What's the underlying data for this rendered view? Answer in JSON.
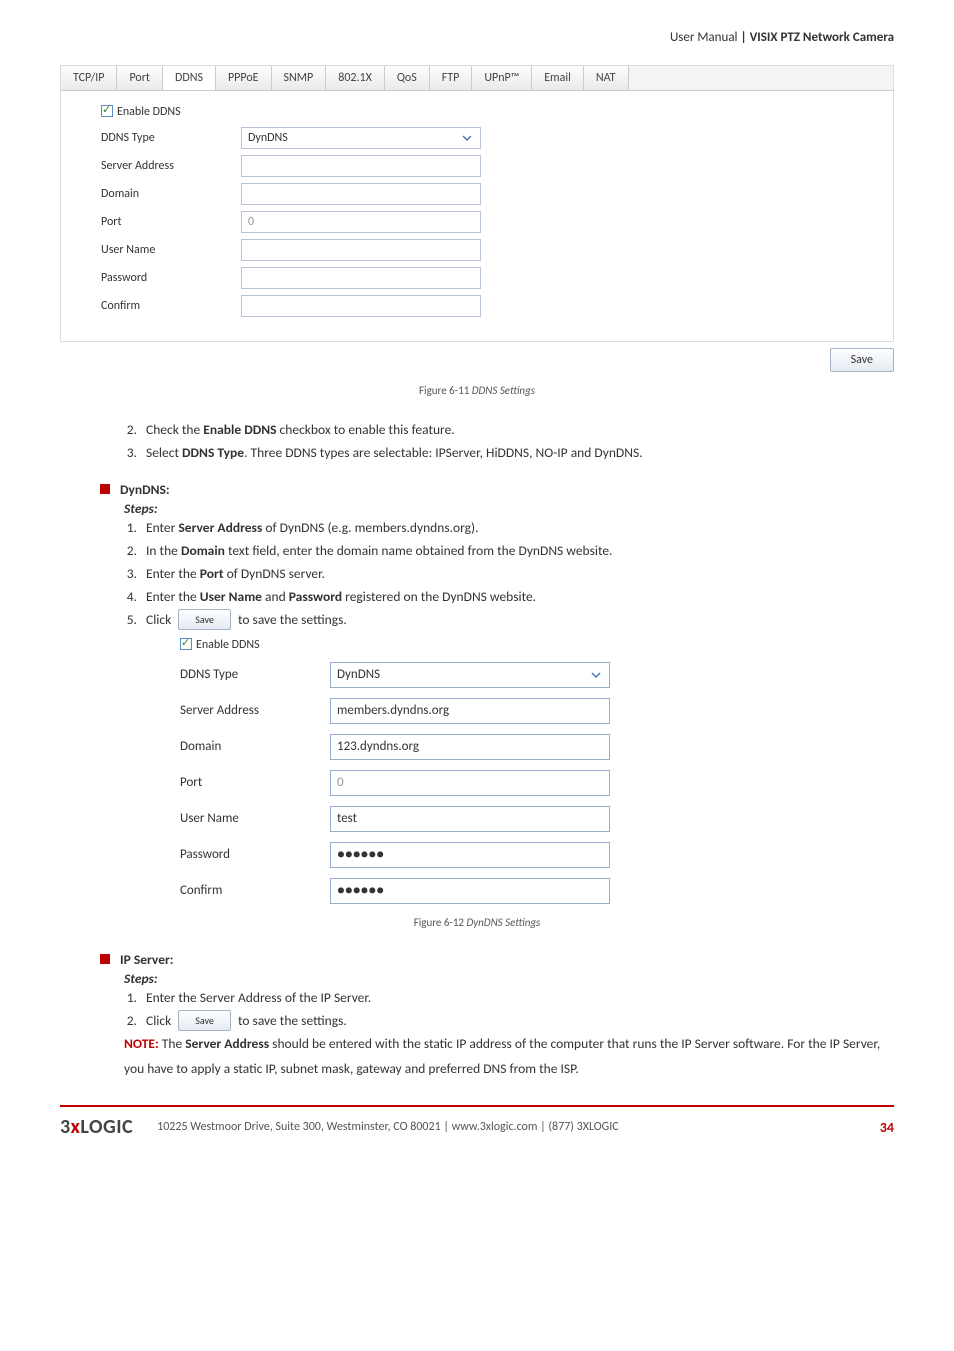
{
  "header": {
    "prefix": "User Manual ",
    "title": "| VISIX PTZ Network Camera"
  },
  "shot1": {
    "tabs": [
      "TCP/IP",
      "Port",
      "DDNS",
      "PPPoE",
      "SNMP",
      "802.1X",
      "QoS",
      "FTP",
      "UPnP™",
      "Email",
      "NAT"
    ],
    "active_tab_index": 2,
    "enable_label": "Enable DDNS",
    "fields": {
      "ddns_type_label": "DDNS Type",
      "ddns_type_value": "DynDNS",
      "server_address_label": "Server Address",
      "server_address_value": "",
      "domain_label": "Domain",
      "domain_value": "",
      "port_label": "Port",
      "port_value": "0",
      "username_label": "User Name",
      "username_value": "",
      "password_label": "Password",
      "password_value": "",
      "confirm_label": "Confirm",
      "confirm_value": ""
    },
    "save_label": "Save"
  },
  "caption1": {
    "prefix": "Figure 6-11 ",
    "ital": "DDNS Settings"
  },
  "list1": {
    "i2_a": "Check the ",
    "i2_b": "Enable DDNS",
    "i2_c": " checkbox to enable this feature.",
    "i3_a": "Select ",
    "i3_b": "DDNS Type",
    "i3_c": ". Three DDNS types are selectable: IPServer, HiDDNS, NO-IP and DynDNS."
  },
  "dyndns": {
    "heading": "DynDNS:",
    "steps_label": "Steps:",
    "s1_a": "Enter ",
    "s1_b": "Server Address",
    "s1_c": " of DynDNS (e.g. members.dyndns.org).",
    "s2_a": "In the ",
    "s2_b": "Domain",
    "s2_c": " text field, enter the domain name obtained from the DynDNS website.",
    "s3_a": "Enter the ",
    "s3_b": "Port",
    "s3_c": " of DynDNS server.",
    "s4_a": "Enter the ",
    "s4_b": "User Name",
    "s4_c": " and ",
    "s4_d": "Password",
    "s4_e": " registered on the DynDNS website.",
    "s5_a": "Click ",
    "s5_btn": "Save",
    "s5_b": " to save the settings."
  },
  "shot2": {
    "enable_label": "Enable DDNS",
    "fields": {
      "ddns_type_label": "DDNS Type",
      "ddns_type_value": "DynDNS",
      "server_address_label": "Server Address",
      "server_address_value": "members.dyndns.org",
      "domain_label": "Domain",
      "domain_value": "123.dyndns.org",
      "port_label": "Port",
      "port_value": "0",
      "username_label": "User Name",
      "username_value": "test",
      "password_label": "Password",
      "password_value": "●●●●●●",
      "confirm_label": "Confirm",
      "confirm_value": "●●●●●●"
    }
  },
  "caption2": {
    "prefix": "Figure 6-12 ",
    "ital": "DynDNS Settings"
  },
  "ipserver": {
    "heading": "IP Server:",
    "steps_label": "Steps:",
    "s1": "Enter the Server Address of the IP Server.",
    "s2_a": "Click ",
    "s2_btn": "Save",
    "s2_b": " to save the settings.",
    "note_label": "NOTE:",
    "note_a": " The ",
    "note_b": "Server Address",
    "note_c": " should be entered with the static IP address of the computer that runs the IP Server software. For the IP Server, you have to apply a static IP, subnet mask, gateway and preferred DNS from the ISP."
  },
  "footer": {
    "address": "10225 Westmoor Drive, Suite 300, Westminster, CO 80021 | www.3xlogic.com | (877) 3XLOGIC",
    "page": "34"
  }
}
